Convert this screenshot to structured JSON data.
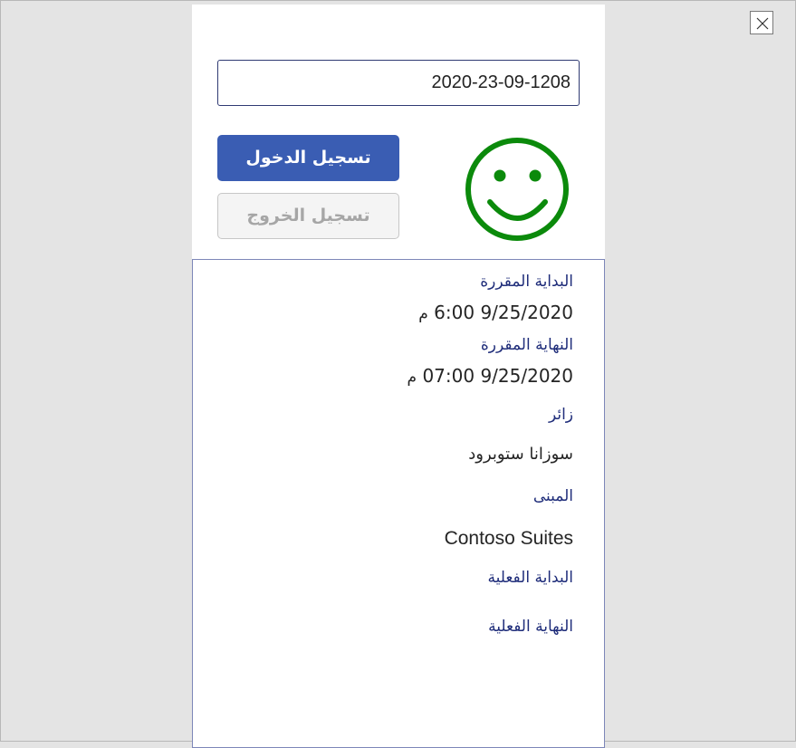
{
  "header": {
    "close_icon": "close-icon"
  },
  "checkin": {
    "code_value": "2020-23-09-1208",
    "checkin_label": "تسجيل الدخول",
    "checkout_label": "تسجيل الخروج",
    "checkout_enabled": false,
    "status_icon": "smiley-face-icon",
    "status_color": "#0b8a0b",
    "primary_color": "#3a5db3"
  },
  "details": {
    "scheduled_start_label": "البداية المقررة",
    "scheduled_start_date": "9/25/2020",
    "scheduled_start_time": "6:00",
    "scheduled_start_suffix": "م",
    "scheduled_end_label": "النهاية المقررة",
    "scheduled_end_date": "9/25/2020",
    "scheduled_end_time": "07:00",
    "scheduled_end_suffix": "م",
    "visitor_label": "زائر",
    "visitor_value": "سوزانا ستوبرود",
    "building_label": "المبنى",
    "building_value": "Contoso Suites",
    "actual_start_label": "البداية الفعلية",
    "actual_end_label": "النهاية الفعلية"
  }
}
